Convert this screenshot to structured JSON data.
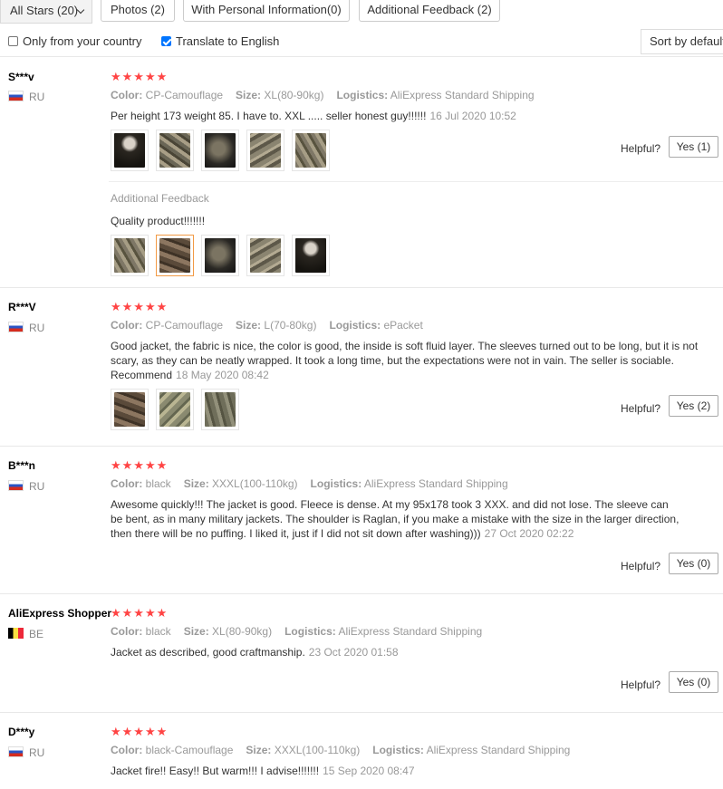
{
  "filters": {
    "stars_select": "All Stars (20)",
    "photos": "Photos (2)",
    "personal_info": "With Personal Information(0)",
    "additional_feedback": "Additional Feedback (2)"
  },
  "options": {
    "only_country": "Only from your country",
    "only_country_checked": false,
    "translate": "Translate to English",
    "translate_checked": true,
    "sort": "Sort by default"
  },
  "labels": {
    "color": "Color:",
    "size": "Size:",
    "logistics": "Logistics:",
    "helpful": "Helpful?",
    "additional_feedback": "Additional Feedback"
  },
  "reviews": [
    {
      "user": "S***v",
      "country": "RU",
      "stars": "★★★★★",
      "color": "CP-Camouflage",
      "size": "XL(80-90kg)",
      "logistics": "AliExpress Standard Shipping",
      "text": "Per height 173 weight 85. I have to. XXL ..... seller honest guy!!!!!!",
      "date": "16 Jul 2020 10:52",
      "helpful": "Yes (1)",
      "additional": {
        "text": "Quality product!!!!!!!",
        "date": ""
      }
    },
    {
      "user": "R***V",
      "country": "RU",
      "stars": "★★★★★",
      "color": "CP-Camouflage",
      "size": "L(70-80kg)",
      "logistics": "ePacket",
      "text": "Good jacket, the fabric is nice, the color is good, the inside is soft fluid layer. The sleeves turned out to be long, but it is not scary, as they can be neatly wrapped. It took a long time, but the expectations were not in vain. The seller is sociable. Recommend",
      "date": "18 May 2020 08:42",
      "helpful": "Yes (2)"
    },
    {
      "user": "B***n",
      "country": "RU",
      "stars": "★★★★★",
      "color": "black",
      "size": "XXXL(100-110kg)",
      "logistics": "AliExpress Standard Shipping",
      "text": "Awesome quickly!!! The jacket is good. Fleece is dense. At my 95x178 took 3 XXX. and did not lose. The sleeve can be bent, as in many military jackets. The shoulder is Raglan, if you make a mistake with the size in the larger direction, then there will be no puffing. I liked it, just if I did not sit down after washing)))",
      "date": "27 Oct 2020 02:22",
      "helpful": "Yes (0)"
    },
    {
      "user": "AliExpress Shopper",
      "country": "BE",
      "stars": "★★★★★",
      "color": "black",
      "size": "XL(80-90kg)",
      "logistics": "AliExpress Standard Shipping",
      "text": "Jacket as described, good craftmanship.",
      "date": "23 Oct 2020 01:58",
      "helpful": "Yes (0)"
    },
    {
      "user": "D***y",
      "country": "RU",
      "stars": "★★★★★",
      "color": "black-Camouflage",
      "size": "XXXL(100-110kg)",
      "logistics": "AliExpress Standard Shipping",
      "text": "Jacket fire!! Easy!! But warm!!! I advise!!!!!!!",
      "date": "15 Sep 2020 08:47"
    }
  ]
}
